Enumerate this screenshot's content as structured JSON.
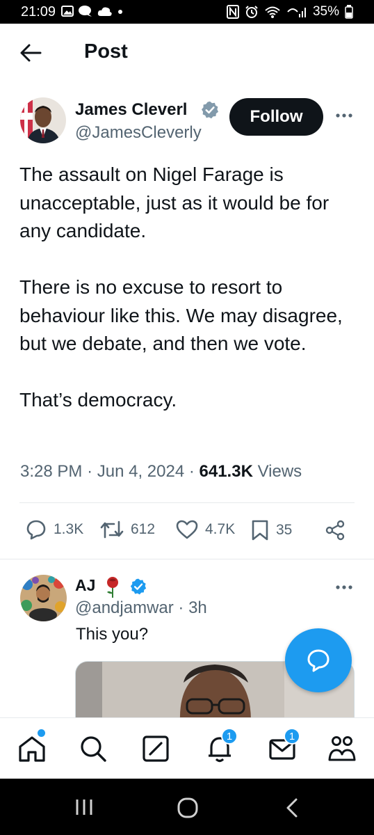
{
  "status_bar": {
    "time": "21:09",
    "battery": "35%"
  },
  "header": {
    "title": "Post"
  },
  "tweet": {
    "author_name": "James Cleverl",
    "author_handle": "@JamesCleverly",
    "follow_label": "Follow",
    "paragraphs": [
      "The assault on Nigel Farage is unacceptable, just as it would be for any candidate.",
      "There is no excuse to resort to behaviour like this. We may disagree, but we debate, and then we vote.",
      "That’s democracy."
    ],
    "time": "3:28 PM",
    "date": "Jun 4, 2024",
    "views_count": "641.3K",
    "views_label": "Views",
    "stats": {
      "replies": "1.3K",
      "reposts": "612",
      "likes": "4.7K",
      "bookmarks": "35"
    }
  },
  "reply": {
    "author_name": "AJ",
    "author_handle": "@andjamwar",
    "age": "3h",
    "text": "This you?"
  },
  "nav": {
    "notifications_badge": "1",
    "messages_badge": "1"
  },
  "colors": {
    "accent": "#1d9bf0",
    "text": "#0f1419",
    "muted": "#536471"
  },
  "icons": [
    "back-arrow-icon",
    "verified-icon",
    "more-icon",
    "reply-icon",
    "repost-icon",
    "like-icon",
    "bookmark-icon",
    "share-icon",
    "compose-icon",
    "home-icon",
    "search-icon",
    "grok-icon",
    "bell-icon",
    "mail-icon",
    "communities-icon"
  ]
}
